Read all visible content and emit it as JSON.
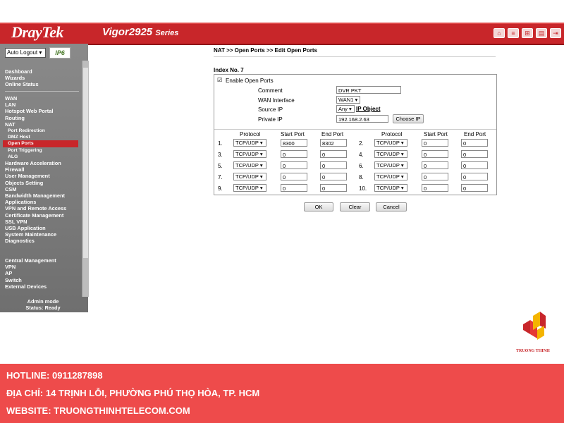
{
  "header": {
    "logo": "DrayTek",
    "model": "Vigor2925",
    "series": "Series",
    "icons": [
      "home-icon",
      "list-icon",
      "grid-icon",
      "table-icon",
      "logout-icon"
    ]
  },
  "sidebar": {
    "auto_logout": "Auto Logout ▾",
    "ipv6": "IP6",
    "items_top": [
      "Dashboard",
      "Wizards",
      "Online Status"
    ],
    "items": [
      "WAN",
      "LAN",
      "Hotspot Web Portal",
      "Routing",
      "NAT"
    ],
    "nat_sub": [
      "Port Redirection",
      "DMZ Host",
      "Open Ports",
      "Port Triggering",
      "ALG"
    ],
    "items_after": [
      "Hardware Acceleration",
      "Firewall",
      "User Management",
      "Objects Setting",
      "CSM",
      "Bandwidth Management",
      "Applications",
      "VPN and Remote Access",
      "Certificate Management",
      "SSL VPN",
      "USB Application",
      "System Maintenance",
      "Diagnostics"
    ],
    "items_central": [
      "Central Management",
      "VPN",
      "AP",
      "Switch",
      "External Devices"
    ],
    "admin_mode": "Admin mode",
    "status": "Status: Ready"
  },
  "main": {
    "breadcrumb": "NAT >> Open Ports >> Edit Open Ports",
    "index": "Index No. 7",
    "enable_label": "Enable Open Ports",
    "comment_label": "Comment",
    "comment_value": "DVR PKT",
    "wan_label": "WAN Interface",
    "wan_value": "WAN1 ▾",
    "source_label": "Source IP",
    "source_value": "Any ▾",
    "ip_object": "IP Object",
    "private_label": "Private IP",
    "private_value": "192.168.2.63",
    "choose_ip": "Choose IP",
    "col_protocol": "Protocol",
    "col_start": "Start Port",
    "col_end": "End Port",
    "rows": [
      {
        "n": "1.",
        "proto": "TCP/UDP ▾",
        "start": "8300",
        "end": "8302"
      },
      {
        "n": "2.",
        "proto": "TCP/UDP ▾",
        "start": "0",
        "end": "0"
      },
      {
        "n": "3.",
        "proto": "TCP/UDP ▾",
        "start": "0",
        "end": "0"
      },
      {
        "n": "4.",
        "proto": "TCP/UDP ▾",
        "start": "0",
        "end": "0"
      },
      {
        "n": "5.",
        "proto": "TCP/UDP ▾",
        "start": "0",
        "end": "0"
      },
      {
        "n": "6.",
        "proto": "TCP/UDP ▾",
        "start": "0",
        "end": "0"
      },
      {
        "n": "7.",
        "proto": "TCP/UDP ▾",
        "start": "0",
        "end": "0"
      },
      {
        "n": "8.",
        "proto": "TCP/UDP ▾",
        "start": "0",
        "end": "0"
      },
      {
        "n": "9.",
        "proto": "TCP/UDP ▾",
        "start": "0",
        "end": "0"
      },
      {
        "n": "10.",
        "proto": "TCP/UDP ▾",
        "start": "0",
        "end": "0"
      }
    ],
    "ok": "OK",
    "clear": "Clear",
    "cancel": "Cancel"
  },
  "footer": {
    "hotline": "HOTLINE: 0911287898",
    "address": "ĐỊA CHỈ: 14 TRỊNH LỖI, PHƯỜNG PHÚ THỌ HÒA, TP. HCM",
    "website": "WEBSITE: TRUONGTHINHTELECOM.COM",
    "brand": "TRUONG THINH"
  },
  "colors": {
    "brand_red": "#c8262a",
    "footer_red": "#ee4b4b"
  }
}
